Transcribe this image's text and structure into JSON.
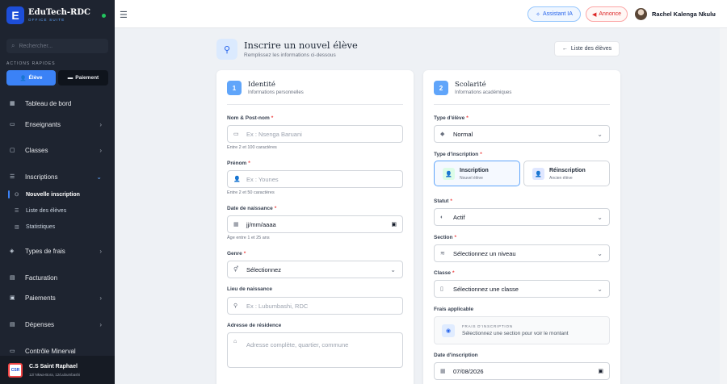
{
  "app": {
    "name": "EduTech-RDC",
    "subtitle": "OFFICE SUITE",
    "logo_letter": "E"
  },
  "sidebar": {
    "search_placeholder": "Rechercher...",
    "quick_actions_title": "ACTIONS RAPIDES",
    "quick_actions": [
      {
        "label": "Élève",
        "icon": "user-plus-icon"
      },
      {
        "label": "Paiement",
        "icon": "money-icon"
      }
    ],
    "items": [
      {
        "label": "Tableau de bord",
        "icon": "dashboard-icon"
      },
      {
        "label": "Enseignants",
        "icon": "monitor-icon"
      },
      {
        "label": "Classes",
        "icon": "lock-icon"
      },
      {
        "label": "Inscriptions",
        "icon": "list-icon"
      },
      {
        "label": "Types de frais",
        "icon": "tag-icon"
      },
      {
        "label": "Facturation",
        "icon": "invoice-icon"
      },
      {
        "label": "Paiements",
        "icon": "wallet-icon"
      },
      {
        "label": "Dépenses",
        "icon": "expense-icon"
      },
      {
        "label": "Contrôle Minerval",
        "icon": "check-icon"
      }
    ],
    "sub_items": [
      {
        "label": "Nouvelle inscription"
      },
      {
        "label": "Liste des élèves"
      },
      {
        "label": "Statistiques"
      }
    ],
    "school": {
      "name": "C.S Saint Raphael",
      "address": "12/ Nkwa-Bora, 12/Lubumbashi",
      "logo_text": "CSR"
    }
  },
  "topbar": {
    "ai_label": "Assistant IA",
    "announce_label": "Annonce",
    "user_name": "Rachel Kalenga Nkulu"
  },
  "page": {
    "title": "Inscrire un nouvel élève",
    "subtitle": "Remplissez les informations ci-dessous",
    "list_button": "Liste des élèves"
  },
  "identity": {
    "step": "1",
    "title": "Identité",
    "subtitle": "Informations personnelles",
    "nom_label": "Nom & Post-nom",
    "nom_placeholder": "Ex : Nsenga Baruani",
    "nom_hint": "Entre 2 et 100 caractères",
    "prenom_label": "Prénom",
    "prenom_placeholder": "Ex : Younes",
    "prenom_hint": "Entre 2 et 50 caractères",
    "dob_label": "Date de naissance",
    "dob_placeholder": "jj/mm/aaaa",
    "dob_hint": "Âge entre 1 et 25 ans",
    "genre_label": "Genre",
    "genre_value": "Sélectionnez",
    "lieu_label": "Lieu de naissance",
    "lieu_placeholder": "Ex : Lubumbashi, RDC",
    "adresse_label": "Adresse de résidence",
    "adresse_placeholder": "Adresse complète, quartier, commune"
  },
  "scolarite": {
    "step": "2",
    "title": "Scolarité",
    "subtitle": "Informations académiques",
    "type_eleve_label": "Type d'élève",
    "type_eleve_value": "Normal",
    "type_insc_label": "Type d'inscription",
    "choices": [
      {
        "title": "Inscription",
        "sub": "Nouvel élève",
        "selected": true
      },
      {
        "title": "Réinscription",
        "sub": "Ancien élève",
        "selected": false
      }
    ],
    "statut_label": "Statut",
    "statut_value": "Actif",
    "section_label": "Section",
    "section_value": "Sélectionnez un niveau",
    "classe_label": "Classe",
    "classe_value": "Sélectionnez une classe",
    "frais_label": "Frais applicable",
    "frais_title": "FRAIS D'INSCRIPTION",
    "frais_desc": "Sélectionnez une section pour voir le montant",
    "date_insc_label": "Date d'inscription",
    "date_insc_value": "07/08/2026"
  },
  "colors": {
    "accent": "#3b82f6",
    "sidebar_bg": "#1e2430",
    "required": "#ef4444"
  }
}
